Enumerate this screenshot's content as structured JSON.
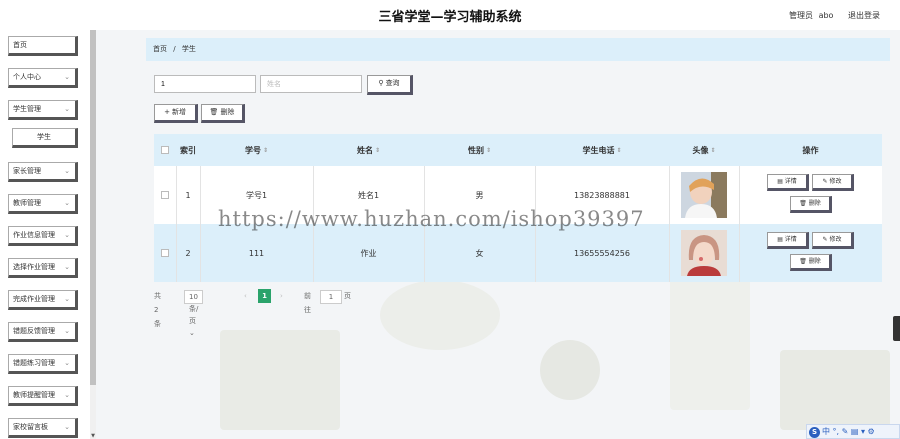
{
  "header": {
    "title": "三省学堂—学习辅助系统",
    "user_role": "管理员",
    "user_name": "abo",
    "logout": "退出登录"
  },
  "sidebar": {
    "items": [
      {
        "label": "首页",
        "expandable": false
      },
      {
        "label": "个人中心",
        "expandable": true
      },
      {
        "label": "学生管理",
        "expandable": true
      },
      {
        "label": "学生",
        "expandable": false,
        "sub": true
      },
      {
        "label": "家长管理",
        "expandable": true
      },
      {
        "label": "教师管理",
        "expandable": true
      },
      {
        "label": "作业信息管理",
        "expandable": true
      },
      {
        "label": "选择作业管理",
        "expandable": true
      },
      {
        "label": "完成作业管理",
        "expandable": true
      },
      {
        "label": "错题反馈管理",
        "expandable": true
      },
      {
        "label": "错题练习管理",
        "expandable": true
      },
      {
        "label": "教师提醒管理",
        "expandable": true
      },
      {
        "label": "家校留言板",
        "expandable": true
      }
    ]
  },
  "breadcrumb": {
    "home": "首页",
    "separator": "/",
    "current": "学生"
  },
  "search": {
    "xuehao_value": "1",
    "name_placeholder": "姓名",
    "query_label": "查询"
  },
  "actions": {
    "add_label": "新增",
    "delete_label": "删除"
  },
  "table": {
    "headers": {
      "index": "索引",
      "xuehao": "学号",
      "name": "姓名",
      "gender": "性别",
      "phone": "学生电话",
      "avatar": "头像",
      "ops": "操作"
    },
    "rows": [
      {
        "index": "1",
        "xuehao": "学号1",
        "name": "姓名1",
        "gender": "男",
        "phone": "13823888881"
      },
      {
        "index": "2",
        "xuehao": "111",
        "name": "作业",
        "gender": "女",
        "phone": "13655554256"
      }
    ],
    "op_labels": {
      "detail": "详情",
      "edit": "修改",
      "delete": "删除"
    }
  },
  "pagination": {
    "total": "共 2 条",
    "page_size": "10条/页",
    "prev": "‹",
    "current_page": "1",
    "next": "›",
    "goto_label": "前往",
    "goto_value": "1",
    "page_unit": "页"
  },
  "watermark": "https://www.huzhan.com/ishop39397",
  "toolbar": {
    "text": "中 °, ✎ ▤ ▾ ⚙"
  },
  "colors": {
    "accent": "#dceffa",
    "active_page": "#2aa36b",
    "row_alt": "#dceffa"
  }
}
